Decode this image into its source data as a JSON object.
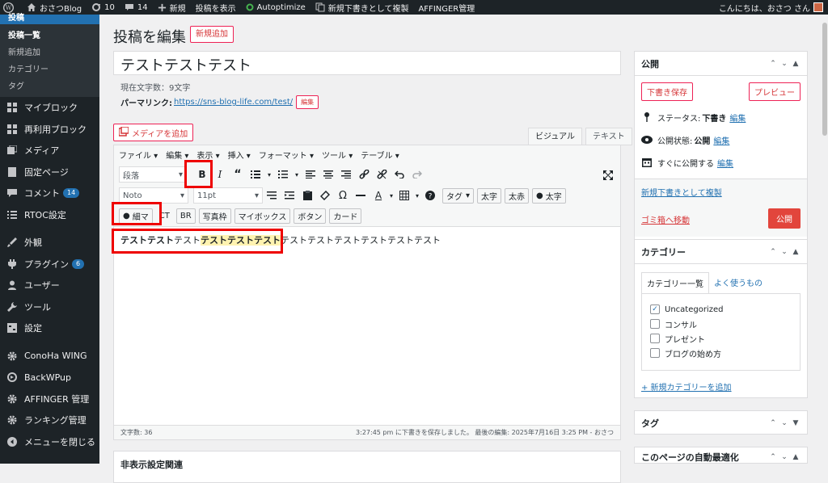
{
  "adminbar": {
    "site_name": "おさつBlog",
    "updates": "10",
    "comments": "14",
    "new": "新規",
    "view_post": "投稿を表示",
    "autoptimize": "Autoptimize",
    "duplicate": "新規下書きとして複製",
    "affinger": "AFFINGER管理",
    "greeting": "こんにちは、おさつ さん"
  },
  "sidebar": {
    "head_label": "投稿",
    "submenu": [
      "投稿一覧",
      "新規追加",
      "カテゴリー",
      "タグ"
    ],
    "items": [
      {
        "label": "マイブロック",
        "icon": "grid-icon"
      },
      {
        "label": "再利用ブロック",
        "icon": "grid-icon"
      },
      {
        "label": "メディア",
        "icon": "media-icon"
      },
      {
        "label": "固定ページ",
        "icon": "page-icon"
      },
      {
        "label": "コメント",
        "icon": "comment-icon",
        "badge": "14"
      },
      {
        "label": "RTOC設定",
        "icon": "list-icon"
      },
      {
        "label": "外観",
        "icon": "brush-icon"
      },
      {
        "label": "プラグイン",
        "icon": "plugin-icon",
        "badge": "6"
      },
      {
        "label": "ユーザー",
        "icon": "user-icon"
      },
      {
        "label": "ツール",
        "icon": "wrench-icon"
      },
      {
        "label": "設定",
        "icon": "settings-icon"
      },
      {
        "label": "ConoHa WING",
        "icon": "gear-icon"
      },
      {
        "label": "BackWPup",
        "icon": "backup-icon"
      },
      {
        "label": "AFFINGER 管理",
        "icon": "gear-icon"
      },
      {
        "label": "ランキング管理",
        "icon": "gear-icon"
      },
      {
        "label": "メニューを閉じる",
        "icon": "collapse-icon"
      }
    ]
  },
  "main": {
    "page_title": "投稿を編集",
    "add_new": "新規追加",
    "post_title": "テストテストテスト",
    "wordcount": "現在文字数：9文字",
    "permalink_label": "パーマリンク:",
    "permalink_url": "https://sns-blog-life.com/test/",
    "edit": "編集",
    "add_media": "メディアを追加",
    "tab_visual": "ビジュアル",
    "tab_text": "テキスト"
  },
  "editor": {
    "menu": [
      "ファイル ▾",
      "編集 ▾",
      "表示 ▾",
      "挿入 ▾",
      "フォーマット ▾",
      "ツール ▾",
      "テーブル ▾"
    ],
    "format_select": "段落",
    "font_select": "Noto",
    "size_select": "11pt",
    "tag_select": "タグ",
    "btn_bold_jp": "太字",
    "btn_bold_red": "太赤",
    "btn_bold_circle": "太字",
    "row3_buttons": [
      "細マ",
      "CT",
      "BR",
      "写真枠",
      "マイボックス",
      "ボタン",
      "カード"
    ],
    "content_bold1": "テストテスト",
    "content_normal1": "テスト",
    "content_bold2": "テストテストテスト",
    "content_normal2": "テストテストテストテストテストテスト",
    "char_count": "文字数: 36",
    "saved_status": "3:27:45 pm に下書きを保存しました。 最後の編集: 2025年7月16日 3:25 PM - おさつ"
  },
  "below_box_title": "非表示設定関連",
  "publish": {
    "title": "公開",
    "save_draft": "下書き保存",
    "preview": "プレビュー",
    "status_label": "ステータス:",
    "status_value": "下書き",
    "visibility_label": "公開状態:",
    "visibility_value": "公開",
    "schedule_label": "すぐに公開する",
    "edit": "編集",
    "duplicate_link": "新規下書きとして複製",
    "trash_link": "ゴミ箱へ移動",
    "publish_btn": "公開"
  },
  "categories": {
    "title": "カテゴリー",
    "tab_all": "カテゴリー一覧",
    "tab_popular": "よく使うもの",
    "items": [
      {
        "label": "Uncategorized",
        "checked": "✓"
      },
      {
        "label": "コンサル",
        "checked": ""
      },
      {
        "label": "プレゼント",
        "checked": ""
      },
      {
        "label": "ブログの始め方",
        "checked": ""
      }
    ],
    "add_new": "+ 新規カテゴリーを追加"
  },
  "tags": {
    "title": "タグ"
  },
  "optimize": {
    "title": "このページの自動最適化"
  },
  "colors": {
    "accent": "#2271b1",
    "danger": "#d63638",
    "admin_bg": "#1d2327",
    "highlight_box": "#ee0000"
  }
}
